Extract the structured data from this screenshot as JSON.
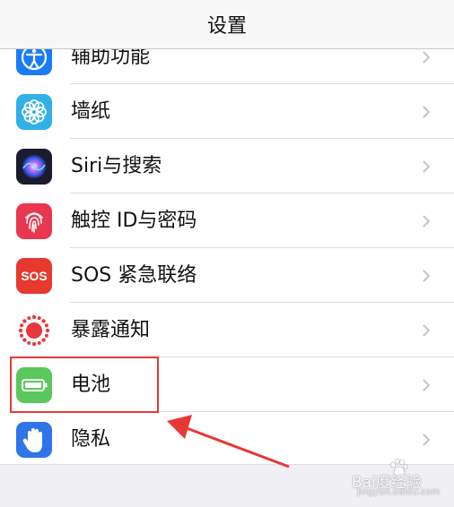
{
  "header": {
    "title": "设置"
  },
  "settings": {
    "items": [
      {
        "label": "辅助功能",
        "icon": "accessibility-icon"
      },
      {
        "label": "墙纸",
        "icon": "wallpaper-icon"
      },
      {
        "label": "Siri与搜索",
        "icon": "siri-icon"
      },
      {
        "label": "触控 ID与密码",
        "icon": "fingerprint-icon"
      },
      {
        "label": "SOS 紧急联络",
        "icon": "sos-icon",
        "icon_text": "SOS"
      },
      {
        "label": "暴露通知",
        "icon": "exposure-notification-icon"
      },
      {
        "label": "电池",
        "icon": "battery-icon"
      },
      {
        "label": "隐私",
        "icon": "privacy-hand-icon"
      }
    ]
  },
  "colors": {
    "accessibility": "#1a7cf5",
    "wallpaper": "#30b0e6",
    "siri": "#1b1b2e",
    "fingerprint": "#e8384f",
    "sos": "#e53a2f",
    "exposure": "#ffffff",
    "battery": "#5ac85a",
    "privacy": "#2f74e8",
    "highlight": "#e53935"
  },
  "watermark": {
    "text": "Bai度经验",
    "site": "jingyan.baidu.com"
  }
}
